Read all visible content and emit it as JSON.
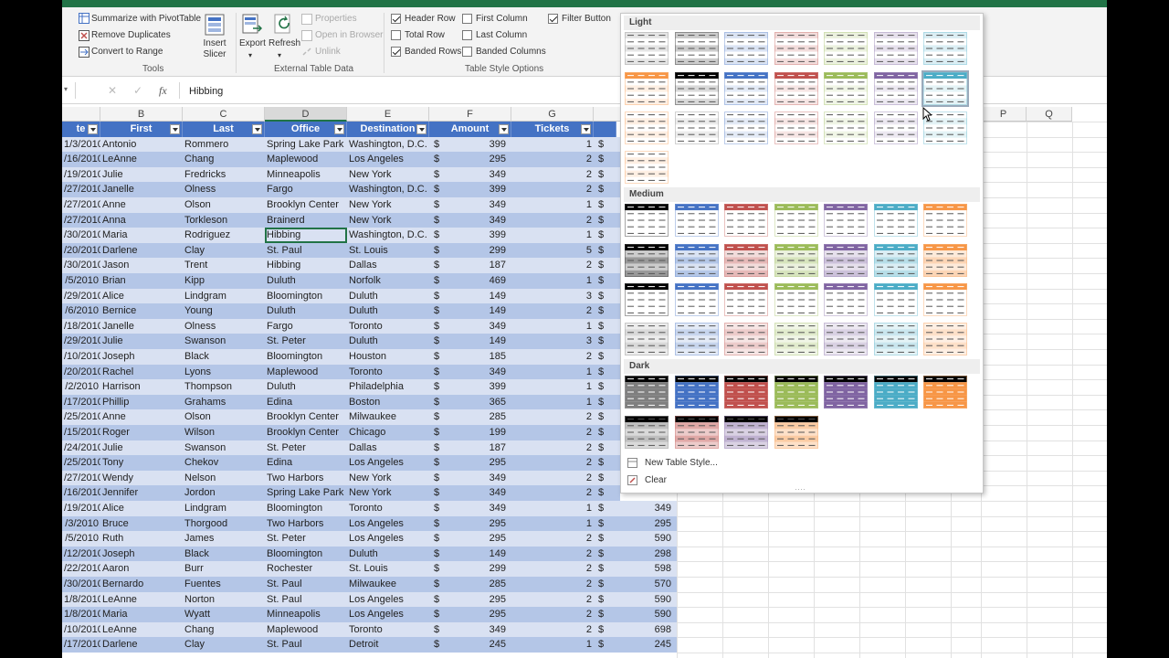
{
  "ribbon": {
    "tools": {
      "pivot": "Summarize with PivotTable",
      "dupes": "Remove Duplicates",
      "range": "Convert to Range",
      "insert_slicer": "Insert Slicer",
      "group": "Tools"
    },
    "external": {
      "export": "Export",
      "refresh": "Refresh",
      "properties": "Properties",
      "open_browser": "Open in Browser",
      "unlink": "Unlink",
      "group": "External Table Data"
    },
    "style_options": {
      "header_row": "Header Row",
      "total_row": "Total Row",
      "banded_rows": "Banded Rows",
      "first_column": "First Column",
      "last_column": "Last Column",
      "banded_columns": "Banded Columns",
      "filter_button": "Filter Button",
      "group": "Table Style Options",
      "checked": {
        "header_row": true,
        "total_row": false,
        "banded_rows": true,
        "first_column": false,
        "last_column": false,
        "banded_columns": false,
        "filter_button": true
      }
    }
  },
  "formula_bar": {
    "value": "Hibbing"
  },
  "grid": {
    "columns": [
      "B",
      "C",
      "D",
      "E",
      "F",
      "G",
      "P",
      "Q"
    ],
    "selected_column": "D",
    "headers": [
      "te",
      "First",
      "Last",
      "Office",
      "Destination",
      "Amount",
      "Tickets"
    ],
    "rows": [
      [
        "1/3/2010",
        "Antonio",
        "Rommero",
        "Spring Lake Park",
        "Washington, D.C.",
        "399",
        "1"
      ],
      [
        "/16/2010",
        "LeAnne",
        "Chang",
        "Maplewood",
        "Los Angeles",
        "295",
        "2"
      ],
      [
        "/19/2010",
        "Julie",
        "Fredricks",
        "Minneapolis",
        "New York",
        "349",
        "2"
      ],
      [
        "/27/2010",
        "Janelle",
        "Olness",
        "Fargo",
        "Washington, D.C.",
        "399",
        "2"
      ],
      [
        "/27/2010",
        "Anne",
        "Olson",
        "Brooklyn Center",
        "New York",
        "349",
        "1"
      ],
      [
        "/27/2010",
        "Anna",
        "Torkleson",
        "Brainerd",
        "New York",
        "349",
        "2"
      ],
      [
        "/30/2010",
        "Maria",
        "Rodriguez",
        "Hibbing",
        "Washington, D.C.",
        "399",
        "1"
      ],
      [
        "/20/2010",
        "Darlene",
        "Clay",
        "St. Paul",
        "St. Louis",
        "299",
        "5"
      ],
      [
        "/30/2010",
        "Jason",
        "Trent",
        "Hibbing",
        "Dallas",
        "187",
        "2"
      ],
      [
        "/5/2010",
        "Brian",
        "Kipp",
        "Duluth",
        "Norfolk",
        "469",
        "1"
      ],
      [
        "/29/2010",
        "Alice",
        "Lindgram",
        "Bloomington",
        "Duluth",
        "149",
        "3"
      ],
      [
        "/6/2010",
        "Bernice",
        "Young",
        "Duluth",
        "Duluth",
        "149",
        "2"
      ],
      [
        "/18/2010",
        "Janelle",
        "Olness",
        "Fargo",
        "Toronto",
        "349",
        "1"
      ],
      [
        "/29/2010",
        "Julie",
        "Swanson",
        "St. Peter",
        "Duluth",
        "149",
        "3"
      ],
      [
        "/10/2010",
        "Joseph",
        "Black",
        "Bloomington",
        "Houston",
        "185",
        "2"
      ],
      [
        "/20/2010",
        "Rachel",
        "Lyons",
        "Maplewood",
        "Toronto",
        "349",
        "1"
      ],
      [
        "/2/2010",
        "Harrison",
        "Thompson",
        "Duluth",
        "Philadelphia",
        "399",
        "1"
      ],
      [
        "/17/2010",
        "Phillip",
        "Grahams",
        "Edina",
        "Boston",
        "365",
        "1"
      ],
      [
        "/25/2010",
        "Anne",
        "Olson",
        "Brooklyn Center",
        "Milwaukee",
        "285",
        "2"
      ],
      [
        "/15/2010",
        "Roger",
        "Wilson",
        "Brooklyn Center",
        "Chicago",
        "199",
        "2"
      ],
      [
        "/24/2010",
        "Julie",
        "Swanson",
        "St. Peter",
        "Dallas",
        "187",
        "2"
      ],
      [
        "/25/2010",
        "Tony",
        "Chekov",
        "Edina",
        "Los Angeles",
        "295",
        "2"
      ],
      [
        "/27/2010",
        "Wendy",
        "Nelson",
        "Two Harbors",
        "New York",
        "349",
        "2"
      ],
      [
        "/16/2010",
        "Jennifer",
        "Jordon",
        "Spring Lake Park",
        "New York",
        "349",
        "2"
      ],
      [
        "/19/2010",
        "Alice",
        "Lindgram",
        "Bloomington",
        "Toronto",
        "349",
        "1"
      ],
      [
        "/3/2010",
        "Bruce",
        "Thorgood",
        "Two Harbors",
        "Los Angeles",
        "295",
        "1"
      ],
      [
        "/5/2010",
        "Ruth",
        "James",
        "St. Peter",
        "Los Angeles",
        "295",
        "2"
      ],
      [
        "/12/2010",
        "Joseph",
        "Black",
        "Bloomington",
        "Duluth",
        "149",
        "2"
      ],
      [
        "/22/2010",
        "Aaron",
        "Burr",
        "Rochester",
        "St. Louis",
        "299",
        "2"
      ],
      [
        "/30/2010",
        "Bernardo",
        "Fuentes",
        "St. Paul",
        "Milwaukee",
        "285",
        "2"
      ],
      [
        "1/8/2010",
        "LeAnne",
        "Norton",
        "St. Paul",
        "Los Angeles",
        "295",
        "2"
      ],
      [
        "1/8/2010",
        "Maria",
        "Wyatt",
        "Minneapolis",
        "Los Angeles",
        "295",
        "2"
      ],
      [
        "/10/2010",
        "LeAnne",
        "Chang",
        "Maplewood",
        "Toronto",
        "349",
        "2"
      ],
      [
        "/17/2010",
        "Darlene",
        "Clay",
        "St. Paul",
        "Detroit",
        "245",
        "1"
      ]
    ],
    "dollar": "$",
    "totals_visible": [
      {
        "row": 25,
        "value": "349"
      },
      {
        "row": 26,
        "value": "295"
      },
      {
        "row": 27,
        "value": "590"
      },
      {
        "row": 28,
        "value": "298"
      },
      {
        "row": 29,
        "value": "598"
      },
      {
        "row": 30,
        "value": "570"
      },
      {
        "row": 31,
        "value": "590"
      },
      {
        "row": 32,
        "value": "590"
      },
      {
        "row": 33,
        "value": "698"
      },
      {
        "row": 34,
        "value": "245"
      }
    ]
  },
  "gallery": {
    "light": "Light",
    "medium": "Medium",
    "dark": "Dark",
    "new_style": "New Table Style...",
    "clear": "Clear",
    "colors": [
      "#000000",
      "#4472c4",
      "#c0504d",
      "#9bbb59",
      "#8064a2",
      "#4bacc6",
      "#f79646",
      "#7f7f7f"
    ]
  }
}
